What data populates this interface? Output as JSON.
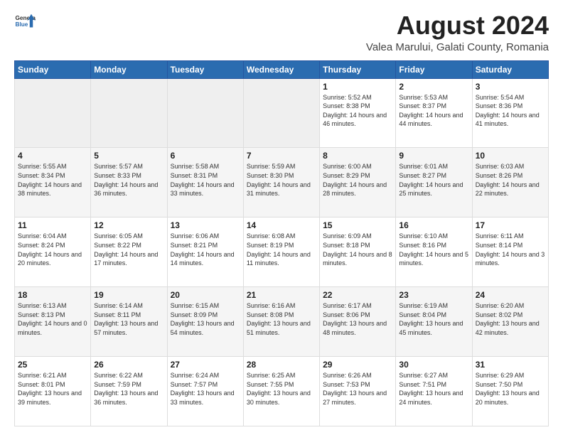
{
  "header": {
    "logo_general": "General",
    "logo_blue": "Blue",
    "main_title": "August 2024",
    "subtitle": "Valea Marului, Galati County, Romania"
  },
  "days_of_week": [
    "Sunday",
    "Monday",
    "Tuesday",
    "Wednesday",
    "Thursday",
    "Friday",
    "Saturday"
  ],
  "weeks": [
    [
      {
        "day": "",
        "info": ""
      },
      {
        "day": "",
        "info": ""
      },
      {
        "day": "",
        "info": ""
      },
      {
        "day": "",
        "info": ""
      },
      {
        "day": "1",
        "info": "Sunrise: 5:52 AM\nSunset: 8:38 PM\nDaylight: 14 hours and 46 minutes."
      },
      {
        "day": "2",
        "info": "Sunrise: 5:53 AM\nSunset: 8:37 PM\nDaylight: 14 hours and 44 minutes."
      },
      {
        "day": "3",
        "info": "Sunrise: 5:54 AM\nSunset: 8:36 PM\nDaylight: 14 hours and 41 minutes."
      }
    ],
    [
      {
        "day": "4",
        "info": "Sunrise: 5:55 AM\nSunset: 8:34 PM\nDaylight: 14 hours and 38 minutes."
      },
      {
        "day": "5",
        "info": "Sunrise: 5:57 AM\nSunset: 8:33 PM\nDaylight: 14 hours and 36 minutes."
      },
      {
        "day": "6",
        "info": "Sunrise: 5:58 AM\nSunset: 8:31 PM\nDaylight: 14 hours and 33 minutes."
      },
      {
        "day": "7",
        "info": "Sunrise: 5:59 AM\nSunset: 8:30 PM\nDaylight: 14 hours and 31 minutes."
      },
      {
        "day": "8",
        "info": "Sunrise: 6:00 AM\nSunset: 8:29 PM\nDaylight: 14 hours and 28 minutes."
      },
      {
        "day": "9",
        "info": "Sunrise: 6:01 AM\nSunset: 8:27 PM\nDaylight: 14 hours and 25 minutes."
      },
      {
        "day": "10",
        "info": "Sunrise: 6:03 AM\nSunset: 8:26 PM\nDaylight: 14 hours and 22 minutes."
      }
    ],
    [
      {
        "day": "11",
        "info": "Sunrise: 6:04 AM\nSunset: 8:24 PM\nDaylight: 14 hours and 20 minutes."
      },
      {
        "day": "12",
        "info": "Sunrise: 6:05 AM\nSunset: 8:22 PM\nDaylight: 14 hours and 17 minutes."
      },
      {
        "day": "13",
        "info": "Sunrise: 6:06 AM\nSunset: 8:21 PM\nDaylight: 14 hours and 14 minutes."
      },
      {
        "day": "14",
        "info": "Sunrise: 6:08 AM\nSunset: 8:19 PM\nDaylight: 14 hours and 11 minutes."
      },
      {
        "day": "15",
        "info": "Sunrise: 6:09 AM\nSunset: 8:18 PM\nDaylight: 14 hours and 8 minutes."
      },
      {
        "day": "16",
        "info": "Sunrise: 6:10 AM\nSunset: 8:16 PM\nDaylight: 14 hours and 5 minutes."
      },
      {
        "day": "17",
        "info": "Sunrise: 6:11 AM\nSunset: 8:14 PM\nDaylight: 14 hours and 3 minutes."
      }
    ],
    [
      {
        "day": "18",
        "info": "Sunrise: 6:13 AM\nSunset: 8:13 PM\nDaylight: 14 hours and 0 minutes."
      },
      {
        "day": "19",
        "info": "Sunrise: 6:14 AM\nSunset: 8:11 PM\nDaylight: 13 hours and 57 minutes."
      },
      {
        "day": "20",
        "info": "Sunrise: 6:15 AM\nSunset: 8:09 PM\nDaylight: 13 hours and 54 minutes."
      },
      {
        "day": "21",
        "info": "Sunrise: 6:16 AM\nSunset: 8:08 PM\nDaylight: 13 hours and 51 minutes."
      },
      {
        "day": "22",
        "info": "Sunrise: 6:17 AM\nSunset: 8:06 PM\nDaylight: 13 hours and 48 minutes."
      },
      {
        "day": "23",
        "info": "Sunrise: 6:19 AM\nSunset: 8:04 PM\nDaylight: 13 hours and 45 minutes."
      },
      {
        "day": "24",
        "info": "Sunrise: 6:20 AM\nSunset: 8:02 PM\nDaylight: 13 hours and 42 minutes."
      }
    ],
    [
      {
        "day": "25",
        "info": "Sunrise: 6:21 AM\nSunset: 8:01 PM\nDaylight: 13 hours and 39 minutes."
      },
      {
        "day": "26",
        "info": "Sunrise: 6:22 AM\nSunset: 7:59 PM\nDaylight: 13 hours and 36 minutes."
      },
      {
        "day": "27",
        "info": "Sunrise: 6:24 AM\nSunset: 7:57 PM\nDaylight: 13 hours and 33 minutes."
      },
      {
        "day": "28",
        "info": "Sunrise: 6:25 AM\nSunset: 7:55 PM\nDaylight: 13 hours and 30 minutes."
      },
      {
        "day": "29",
        "info": "Sunrise: 6:26 AM\nSunset: 7:53 PM\nDaylight: 13 hours and 27 minutes."
      },
      {
        "day": "30",
        "info": "Sunrise: 6:27 AM\nSunset: 7:51 PM\nDaylight: 13 hours and 24 minutes."
      },
      {
        "day": "31",
        "info": "Sunrise: 6:29 AM\nSunset: 7:50 PM\nDaylight: 13 hours and 20 minutes."
      }
    ]
  ]
}
